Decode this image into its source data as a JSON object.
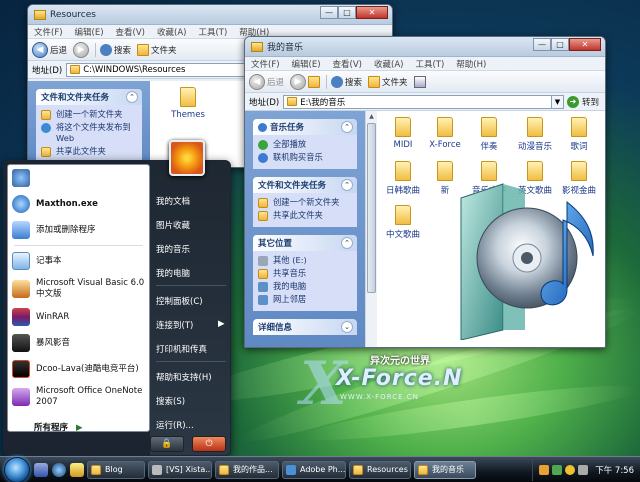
{
  "colors": {
    "accent": "#3b6fb6",
    "start_menu_bg": "#1b2430",
    "taskbar_bg": "#101820"
  },
  "win_resources": {
    "title": "Resources",
    "menu": [
      "文件(F)",
      "编辑(E)",
      "查看(V)",
      "收藏(A)",
      "工具(T)",
      "帮助(H)"
    ],
    "toolbar": {
      "back": "后退",
      "search": "搜索",
      "folders": "文件夹"
    },
    "address_label": "地址(D)",
    "address_value": "C:\\WINDOWS\\Resources",
    "task_group_title": "文件和文件夹任务",
    "tasks": [
      "创建一个新文件夹",
      "将这个文件夹发布到 Web",
      "共享此文件夹"
    ],
    "folders": [
      "Themes"
    ]
  },
  "win_music": {
    "title": "我的音乐",
    "menu": [
      "文件(F)",
      "编辑(E)",
      "查看(V)",
      "收藏(A)",
      "工具(T)",
      "帮助(H)"
    ],
    "toolbar": {
      "back": "后退",
      "search": "搜索",
      "folders": "文件夹"
    },
    "address_label": "地址(D)",
    "address_value": "E:\\我的音乐",
    "go_label": "转到",
    "groups": [
      {
        "title": "音乐任务",
        "items": [
          "全部播放",
          "联机购买音乐"
        ]
      },
      {
        "title": "文件和文件夹任务",
        "items": [
          "创建一个新文件夹",
          "共享此文件夹"
        ]
      },
      {
        "title": "其它位置",
        "items": [
          "其他 (E:)",
          "共享音乐",
          "我的电脑",
          "网上邻居"
        ]
      },
      {
        "title": "详细信息",
        "items": []
      }
    ],
    "folders": [
      "MIDI",
      "X-Force",
      "伴奏",
      "动漫音乐",
      "歌词",
      "日韩歌曲",
      "新",
      "音乐文件",
      "英文歌曲",
      "影视金曲",
      "中文歌曲"
    ]
  },
  "start_menu": {
    "pinned": [
      "Maxthon.exe",
      "添加或删除程序"
    ],
    "recent": [
      "记事本",
      "Microsoft Visual Basic 6.0 中文版",
      "WinRAR",
      "暴风影音",
      "Dcoo-Lava(迪酷电竞平台)",
      "Microsoft Office OneNote 2007"
    ],
    "all_programs": "所有程序",
    "right": [
      "我的文档",
      "图片收藏",
      "我的音乐",
      "我的电脑",
      "控制面板(C)",
      "连接到(T)",
      "打印机和传真",
      "帮助和支持(H)",
      "搜索(S)",
      "运行(R)..."
    ]
  },
  "taskbar": {
    "tasks": [
      "Blog",
      "[VS] Xista...",
      "我的作品...",
      "Adobe Ph...",
      "Resources",
      "我的音乐"
    ],
    "clock": "下午 7:56"
  },
  "brand": {
    "cn": "异次元の世界",
    "force": "X-Force.N",
    "url": "WWW.X-FORCE.CN"
  }
}
